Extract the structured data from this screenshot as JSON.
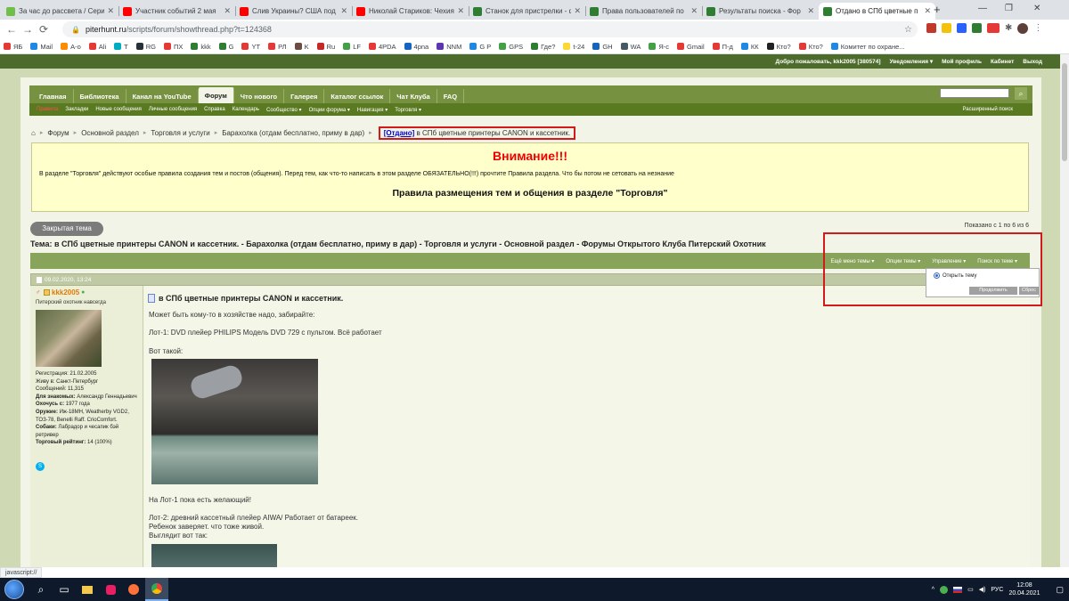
{
  "browser": {
    "tabs": [
      {
        "title": "За час до рассвета / Серия",
        "color": "#6fbf4a"
      },
      {
        "title": "Участник событий 2 мая",
        "color": "#ff0000"
      },
      {
        "title": "Слив Украины? США под",
        "color": "#ff0000"
      },
      {
        "title": "Николай Стариков: Чехия",
        "color": "#ff0000"
      },
      {
        "title": "Станок для пристрелки - ф",
        "color": "#2e7d32"
      },
      {
        "title": "Права пользователей по",
        "color": "#2e7d32"
      },
      {
        "title": "Результаты поиска - Фор",
        "color": "#2e7d32"
      },
      {
        "title": "Отдано в СПб цветные п",
        "color": "#2e7d32",
        "active": true
      }
    ],
    "new_tab": "+",
    "url_host": "piterhunt.ru",
    "url_path": "/scripts/forum/showthread.php?t=124368",
    "bookmarks": [
      "ЯБ",
      "Mail",
      "A-o",
      "Ali",
      "T",
      "RG",
      "ПХ",
      "kkk",
      "G",
      "YT",
      "РЛ",
      "K",
      "Ru",
      "LF",
      "4PDA",
      "4pna",
      "NNM",
      "G P",
      "GPS",
      "Где?",
      "t-24",
      "GH",
      "WA",
      "Я-с",
      "Gmail",
      "П-д",
      "КК",
      "Кто?",
      "Кто?",
      "Комитет по охране..."
    ],
    "bookmark_colors": [
      "#e53935",
      "#1e88e5",
      "#fb8c00",
      "#e53935",
      "#00acc1",
      "#263238",
      "#e53935",
      "#2e7d32",
      "#2e7d32",
      "#e53935",
      "#e53935",
      "#6d4c41",
      "#c62828",
      "#43a047",
      "#e53935",
      "#1565c0",
      "#5e35b1",
      "#1e88e5",
      "#43a047",
      "#2e7d32",
      "#fdd835",
      "#1565c0",
      "#455a64",
      "#43a047",
      "#e53935",
      "#e53935",
      "#1e88e5",
      "#212121",
      "#e53935",
      "#1e88e5"
    ],
    "status_url": "javascript://"
  },
  "forum": {
    "top_user_bar": [
      "Добро пожаловать, kkk2005 [380574]",
      "Уведомления ▾",
      "Мой профиль",
      "Кабинет",
      "Выход"
    ],
    "nav_tabs": [
      "Главная",
      "Библиотека",
      "Канал на YouTube",
      "Форум",
      "Что нового",
      "Галерея",
      "Каталог ссылок",
      "Чат Клуба",
      "FAQ"
    ],
    "sub_nav": [
      "Правила",
      "Закладки",
      "Новые сообщения",
      "Личные сообщения",
      "Справка",
      "Календарь",
      "Сообщество ▾",
      "Опции форума ▾",
      "Навигация ▾",
      "Торговля ▾"
    ],
    "sub_nav_right": "Расширенный поиск",
    "breadcrumb": [
      "Форум",
      "Основной раздел",
      "Торговля и услуги",
      "Барахолка (отдам бесплатно, приму в дар)"
    ],
    "current_status": "[Отдано]",
    "current_title": "в СПб цветные принтеры CANON и кассетник.",
    "notice_title": "Внимание!!!",
    "notice_text": "В разделе \"Торговля\" действуют особые правила создания тем и постов (общения). Перед тем, как что-то написать в этом разделе ОБЯЗАТЕЛЬНО(!!!) прочтите Правила раздела. Что бы потом не сетовать на незнание",
    "notice_rules": "Правила размещения тем и общения в разделе \"Торговля\"",
    "closed_button": "Закрытая тема",
    "shown": "Показано с 1 по 6 из 6",
    "thread_title": "Тема: в СПб цветные принтеры CANON и кассетник. - Барахолка (отдам бесплатно, приму в дар) - Торговля и услуги - Основной раздел - Форумы Открытого Клуба Питерский Охотник",
    "thread_tools": [
      "Ещё мено темы ▾",
      "Опции темы ▾",
      "Управление ▾",
      "Поиск по теме ▾"
    ],
    "dropdown": {
      "option": "Открыть тему",
      "btn_continue": "Продолжить",
      "btn_reset": "Сброс"
    }
  },
  "post": {
    "date": "09.02.2020, 13:24",
    "username": "kkk2005",
    "user_title": "Питерский охотник навсегда",
    "info": [
      {
        "label": "Регистрация:",
        "value": "21.02.2005",
        "bold": false
      },
      {
        "label": "Живу в:",
        "value": "Санкт-Петербург",
        "bold": false
      },
      {
        "label": "Сообщений:",
        "value": "11,315",
        "bold": false
      },
      {
        "label": "Для знакомых:",
        "value": "Александр Геннадьевич",
        "bold": true
      },
      {
        "label": "Охочусь с:",
        "value": "1977 года",
        "bold": true
      },
      {
        "label": "Оружие:",
        "value": "Иж-18МН, Weatherby VGD2, ТОЗ-78, Benelli Raff. CrioComfort.",
        "bold": true
      },
      {
        "label": "Собаки:",
        "value": "Лабрадор и чесапик бэй ретривер",
        "bold": true
      },
      {
        "label": "Торговый рейтинг:",
        "value": "14 (100%)",
        "bold": true
      }
    ],
    "title": "в СПб цветные принтеры CANON и кассетник.",
    "lines": [
      "Может быть кому-то в хозяйстве надо, забирайте:",
      "Лот-1: DVD плейер PHILIPS Модель DVD 729 с пультом. Всё работает",
      "Вот такой:"
    ],
    "lines2": [
      "На Лот-1 пока есть желающий!",
      "Лот-2: древний кассетный плейер AIWA/ Работает от батареек.",
      "Ребенок заверяет. что тоже живой.",
      "Выглядит вот так:"
    ]
  },
  "taskbar": {
    "lang": "РУС",
    "time": "12:08",
    "date": "20.04.2021"
  }
}
